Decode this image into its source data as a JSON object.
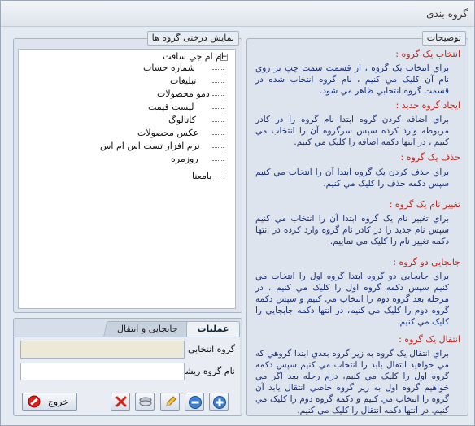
{
  "window": {
    "title": "گروه بندی"
  },
  "description_panel": {
    "legend": "توضیحات",
    "sections": [
      {
        "title": "انتخاب یک گروه :",
        "body": "براي انتخاب يک گروه ، از قسمت سمت چپ بر روي نام آن کليک مي کنيم ، نام گروه انتخاب شده در قسمت گروه انتخابي ظاهر مي شود."
      },
      {
        "title": "ایجاد گروه جدید :",
        "body": "براي اضافه کردن گروه ابتدا نام گروه را در کادر مربوطه وارد کرده سپس سرگروه آن را انتخاب مي کنيم ، در انتها دکمه اضافه را کليک مي کنيم."
      },
      {
        "title": "حذف یک گروه :",
        "body": "براي حذف کردن يک گروه ابتدا آن را انتخاب مي کنيم سپس دکمه حذف را کليک مي کنيم."
      },
      {
        "title": "تغییر نام یک گروه :",
        "body": "براي تغيير نام يک گروه ابتدا آن را انتخاب مي کنيم سپس نام جديد را در کادر نام گروه وارد کرده در انتها دکمه تغيير نام را کليک مي نماييم."
      },
      {
        "title": "جابجایی دو گروه :",
        "body": "براي جابجايي دو گروه ابتدا گروه اول را انتخاب مي کنيم سپس دکمه گروه اول را کليک مي کنيم ، در مرحله بعد گروه دوم را انتخاب مي کنيم و سپس دکمه گروه دوم را کليک مي کنيم، در انتها دکمه جابجايي را کليک مي کنيم."
      },
      {
        "title": "انتقال یک گروه :",
        "body": "براي انتقال يک گروه به زير گروه بعدي ابتدا گروهي که مي خواهيد انتقال يابد را انتخاب مي کنيم سپس دکمه گروه اول را کليک مي کنيم، درم رحله بعد اگر مي خواهيم گروه اول به زير گروه خاصي انتقال يابد آن گروه را انتخاب مي کنيم و دکمه گروه دوم را کليک مي کنيم. در انتها دکمه انتقال را کليک مي کنيم."
      }
    ]
  },
  "tree_panel": {
    "legend": "نمایش درختی گروه ها",
    "toggle": "−",
    "root": "ام ام جي سافت",
    "children": [
      "شماره حساب",
      "تبليغات",
      "دمو محصولات",
      "ليست قيمت",
      "کاتالوگ",
      "عکس محصولات",
      "نرم افزار تست اس ام اس",
      "روزمره"
    ],
    "last": "بامعنا"
  },
  "ops_panel": {
    "tabs": [
      "عملیات",
      "جابجایی و انتقال"
    ],
    "selected_group_label": "گروه انتخابی",
    "selected_group_value": "",
    "root_name_label": "نام گروه ریشه",
    "root_name_value": "",
    "exit_label": "خروج"
  },
  "icons": {
    "add": "plus-icon",
    "remove": "minus-icon",
    "rename": "pencil-icon",
    "swap": "swap-icon",
    "delete": "x-icon",
    "exit": "no-entry-icon"
  },
  "colors": {
    "section_title": "#c0241c",
    "section_body": "#1a2f7a"
  }
}
